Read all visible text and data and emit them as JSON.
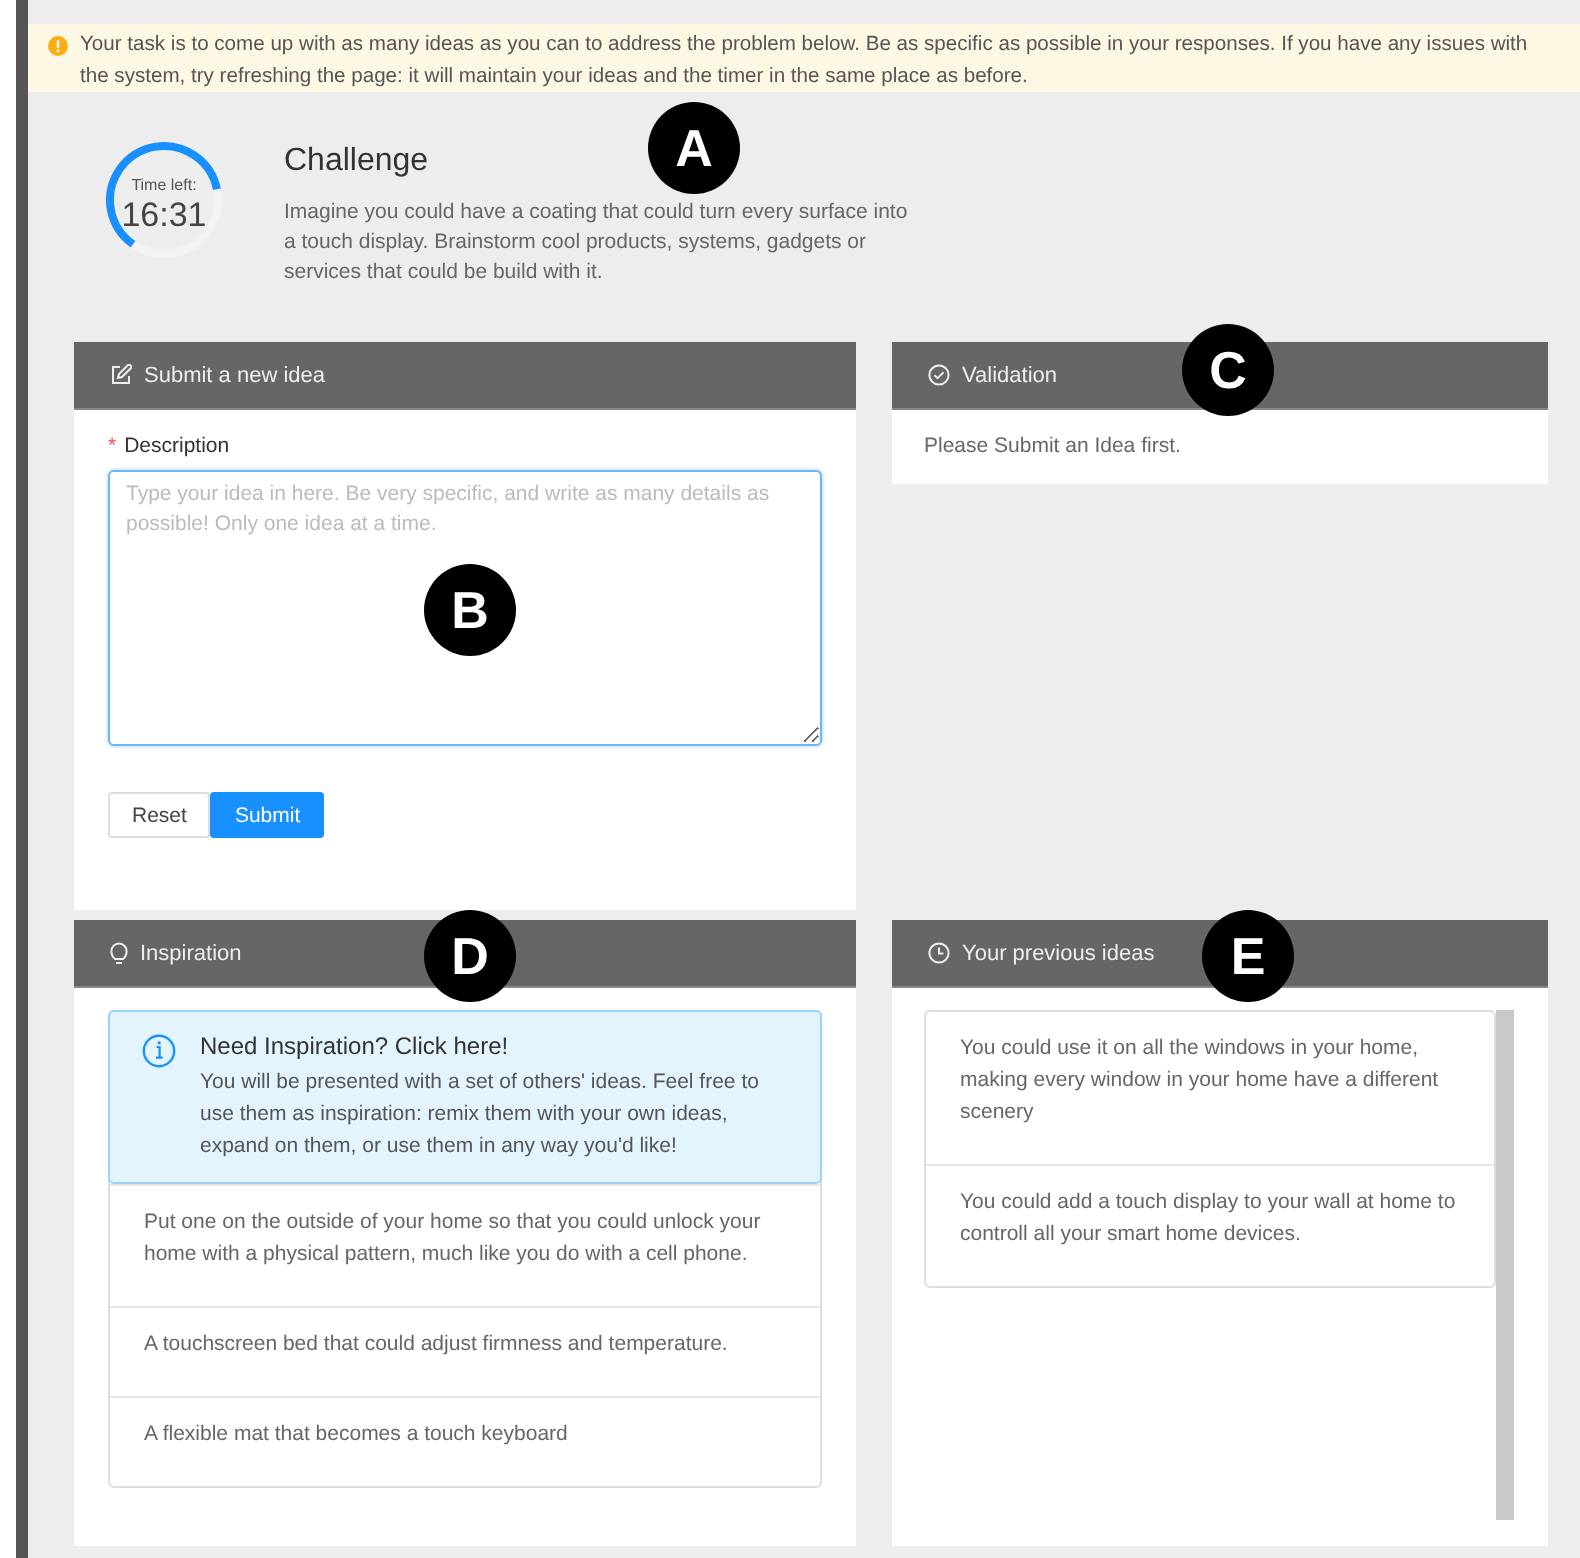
{
  "banner": {
    "text": "Your task is to come up with as many ideas as you can to address the problem below. Be as specific as possible in your responses. If you have any issues with the system, try refreshing the page: it will maintain your ideas and the timer in the same place as before."
  },
  "timer": {
    "label": "Time left:",
    "time": "16:31",
    "level": 0.62
  },
  "challenge": {
    "title": "Challenge",
    "text": "Imagine you could have a coating that could turn every surface into a touch display. Brainstorm cool products, systems, gadgets or services that could be build with it."
  },
  "submit_panel": {
    "title": "Submit a new idea",
    "field_label": "Description",
    "required_mark": "*",
    "placeholder": "Type your idea in here. Be very specific, and write as many details as possible! Only one idea at a time.",
    "buttons": [
      {
        "label": "Reset",
        "kind": "default"
      },
      {
        "label": "Submit",
        "kind": "primary"
      }
    ]
  },
  "validation_panel": {
    "title": "Validation",
    "text": "Please Submit an Idea first."
  },
  "inspiration_panel": {
    "title": "Inspiration",
    "callout": {
      "title": "Need Inspiration? Click here!",
      "text": "You will be presented with a set of others' ideas. Feel free to use them as inspiration: remix them with your own ideas, expand on them, or use them in any way you'd like!"
    },
    "ideas": [
      "Put one on the outside of your home so that you could unlock your home with a physical pattern, much like you do with a cell phone.",
      "A touchscreen bed that could adjust firmness and temperature.",
      "A flexible mat that becomes a touch keyboard"
    ]
  },
  "previous_panel": {
    "title": "Your previous ideas",
    "ideas": [
      "You could use it on all the windows in your home, making every window in your home have a different scenery",
      "You could add a touch display to your wall at home to controll all your smart home devices."
    ]
  },
  "annotations": [
    {
      "label": "A"
    },
    {
      "label": "B"
    },
    {
      "label": "C"
    },
    {
      "label": "D"
    },
    {
      "label": "E"
    }
  ]
}
